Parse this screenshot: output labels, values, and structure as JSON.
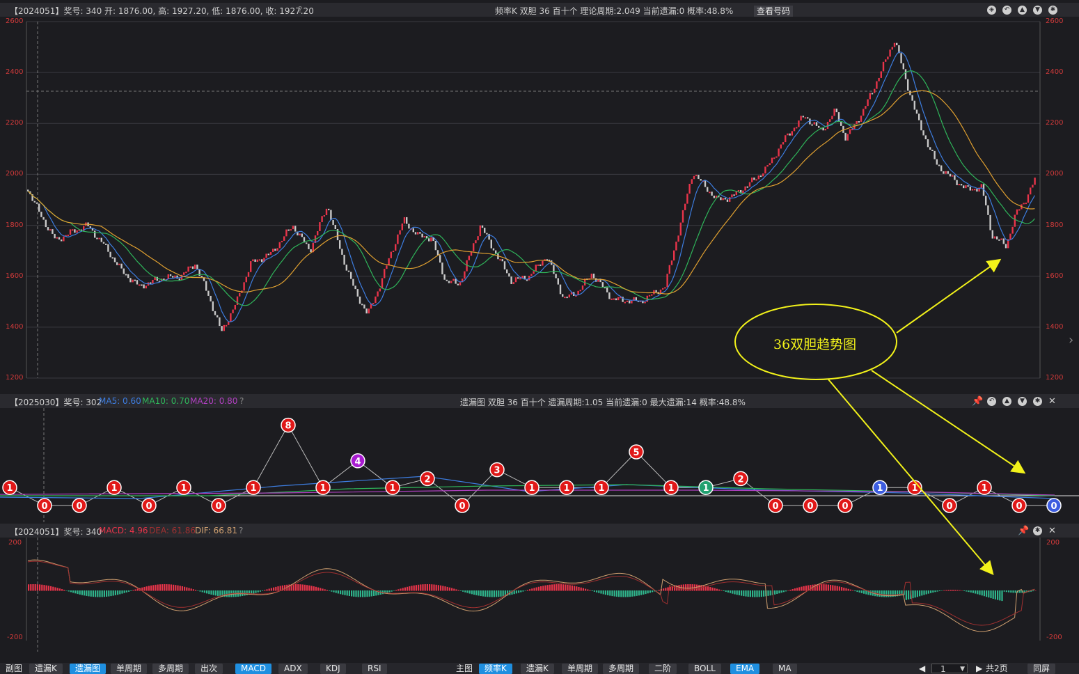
{
  "colors": {
    "up": "#e8344a",
    "down": "#2fb58c",
    "ma5": "#3d7de0",
    "ma10": "#2fb55a",
    "ma20": "#e0a030",
    "grid": "#3a3a40",
    "axis_text": "#d03a3a",
    "accent": "#1f8fe0",
    "annotation": "#f2f21a"
  },
  "main_panel": {
    "info": "【2024051】奖号: 340   开: 1876.00, 高: 1927.20, 低: 1876.00, 收: 1927.20",
    "help_icon": "question-circle-icon",
    "center_info": "频率K   双胆   36   百十个   理论周期:2.049   当前遗漏:0   概率:48.8%",
    "view_button": "查看号码",
    "y_ticks": [
      "2600",
      "2400",
      "2200",
      "2000",
      "1800",
      "1600",
      "1400",
      "1200"
    ],
    "icons": [
      "compass-icon",
      "undo-icon",
      "up-arrow-icon",
      "down-arrow-icon",
      "settings-icon"
    ]
  },
  "miss_panel": {
    "info_prefix": "【2025030】奖号: 302",
    "ma5": "MA5: 0.60",
    "ma10": "MA10: 0.70",
    "ma20": "MA20: 0.80",
    "center_info": "遗漏图   双胆   36   百十个   遗漏周期:1.05   当前遗漏:0   最大遗漏:14   概率:48.8%",
    "points": [
      "1",
      "0",
      "0",
      "1",
      "0",
      "1",
      "0",
      "1",
      "8",
      "1",
      "4",
      "1",
      "2",
      "0",
      "3",
      "1",
      "1",
      "1",
      "5",
      "1",
      "1",
      "2",
      "0",
      "0",
      "0",
      "1",
      "1",
      "0",
      "1",
      "0",
      "0"
    ]
  },
  "macd_panel": {
    "info_prefix": "【2024051】奖号: 340",
    "macd": "MACD: 4.96",
    "dea": "DEA: 61.86",
    "dif": "DIF: 66.81",
    "y_ticks": [
      "200",
      "-200"
    ]
  },
  "annotation": {
    "text": "36双胆趋势图"
  },
  "bottom_bar": {
    "sub_label": "副图",
    "sub_tabs": [
      "遗漏K",
      "遗漏图",
      "单周期",
      "多周期",
      "出次",
      "MACD",
      "ADX",
      "KDJ",
      "RSI"
    ],
    "main_label": "主图",
    "main_tabs": [
      "频率K",
      "遗漏K",
      "单周期",
      "多周期",
      "二阶",
      "BOLL",
      "EMA",
      "MA"
    ],
    "page_value": "1",
    "page_total": "共2页",
    "sync": "同屏"
  }
}
